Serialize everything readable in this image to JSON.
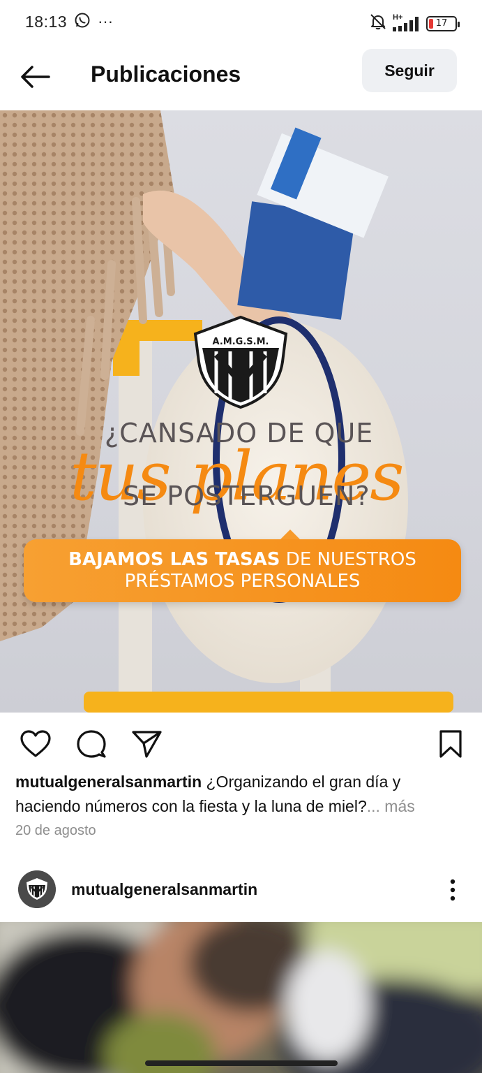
{
  "status_bar": {
    "time": "18:13",
    "more_dots": "···",
    "network": "H+",
    "battery_level": "17",
    "icons": [
      "whatsapp-icon",
      "more-dots-icon",
      "muted-bell-icon",
      "signal-icon",
      "battery-icon"
    ]
  },
  "header": {
    "title": "Publicaciones",
    "follow_label": "Seguir",
    "icons": [
      "back-arrow-icon"
    ]
  },
  "post": {
    "image": {
      "logo_text": "A.M.G.S.M.",
      "headline_line1": "¿CANSADO DE QUE",
      "headline_script": "tus planes",
      "headline_line3": "SE POSTERGUEN?",
      "pill_bold": "BAJAMOS LAS TASAS",
      "pill_rest": " DE NUESTROS",
      "pill_line2": "PRÉSTAMOS PERSONALES"
    },
    "actions": [
      "heart-icon",
      "comment-icon",
      "share-icon",
      "bookmark-icon"
    ],
    "caption_user": "mutualgeneralsanmartin",
    "caption_text": " ¿Organizando el gran día y haciendo números con la fiesta y la luna de miel?",
    "caption_more": "... más",
    "date": "20 de agosto"
  },
  "next_post": {
    "username": "mutualgeneralsanmartin",
    "icons": [
      "avatar-logo-icon",
      "kebab-menu-icon"
    ]
  },
  "colors": {
    "accent_orange": "#f58a12",
    "follow_bg": "#eef0f3",
    "muted_text": "#8e8e8e",
    "battery_low": "#e53935"
  }
}
